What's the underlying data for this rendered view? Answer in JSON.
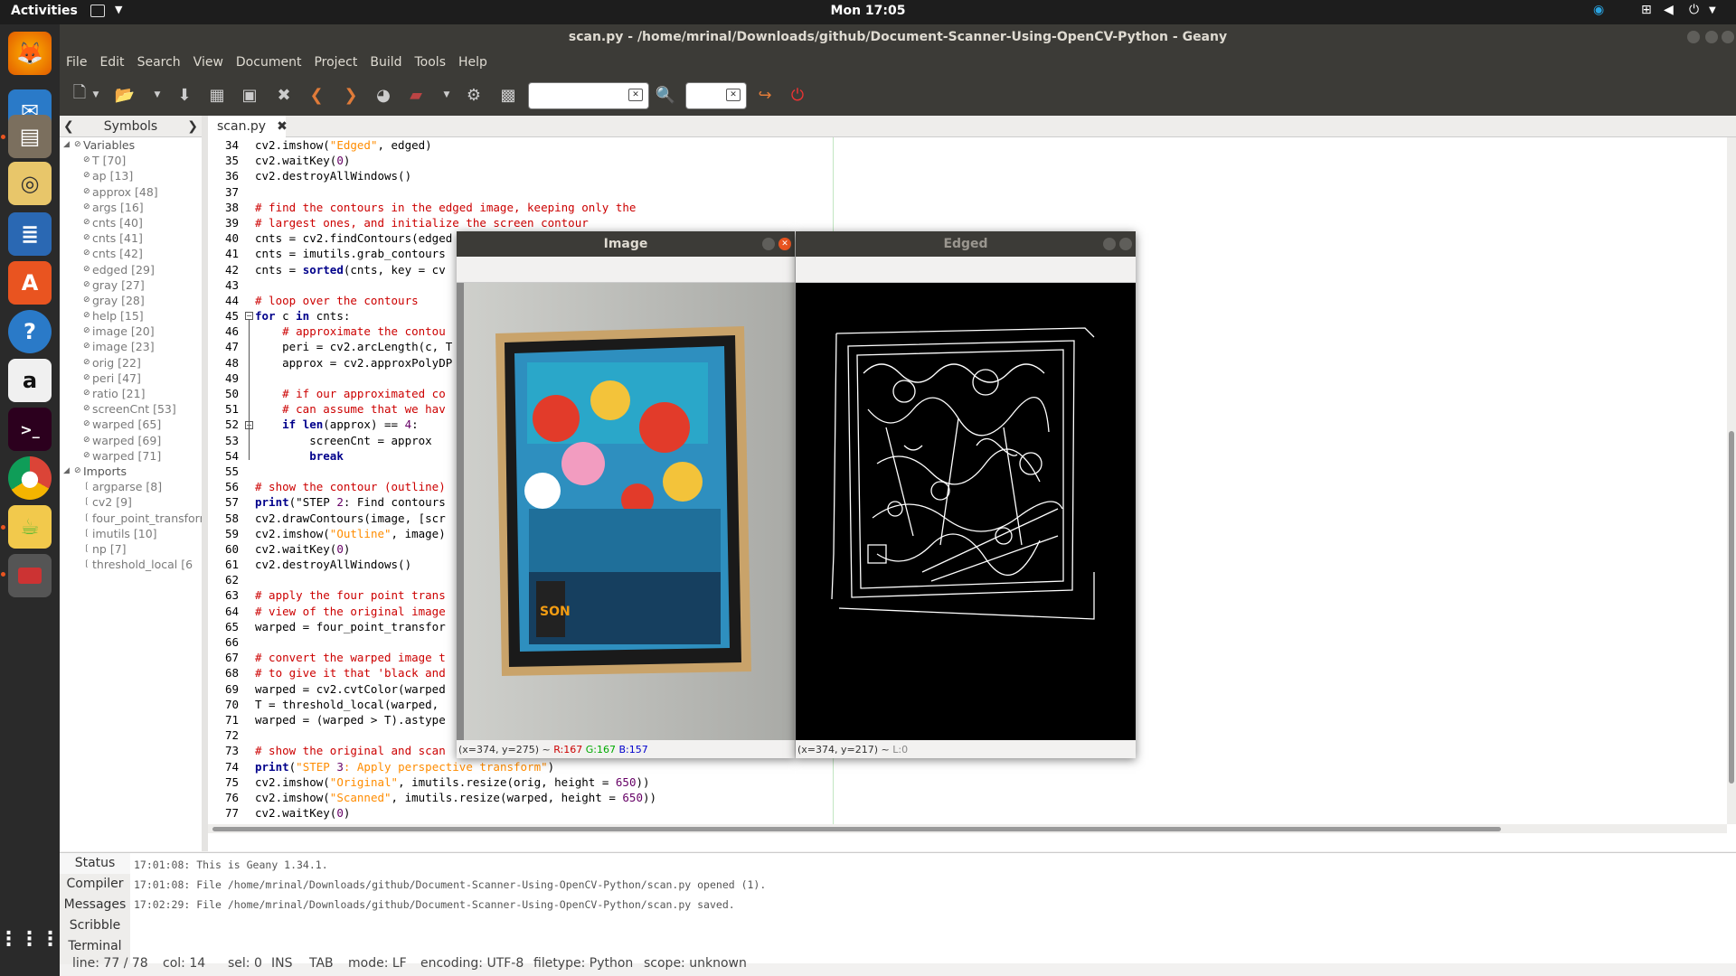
{
  "topbar": {
    "activities": "Activities",
    "clock": "Mon 17:05"
  },
  "dock": {
    "items": [
      "firefox-icon",
      "thunderbird-icon",
      "files-icon",
      "rhythmbox-icon",
      "writer-icon",
      "software-center-icon",
      "help-icon",
      "amazon-icon",
      "terminal-icon",
      "chrome-icon",
      "geany-icon",
      "app-icon"
    ]
  },
  "window": {
    "title": "scan.py - /home/mrinal/Downloads/github/Document-Scanner-Using-OpenCV-Python - Geany"
  },
  "menu": [
    "File",
    "Edit",
    "Search",
    "View",
    "Document",
    "Project",
    "Build",
    "Tools",
    "Help"
  ],
  "sidebar": {
    "title": "Symbols",
    "variables_label": "Variables",
    "variables": [
      "T [70]",
      "ap [13]",
      "approx [48]",
      "args [16]",
      "cnts [40]",
      "cnts [41]",
      "cnts [42]",
      "edged [29]",
      "gray [27]",
      "gray [28]",
      "help [15]",
      "image [20]",
      "image [23]",
      "orig [22]",
      "peri [47]",
      "ratio [21]",
      "screenCnt [53]",
      "warped [65]",
      "warped [69]",
      "warped [71]"
    ],
    "imports_label": "Imports",
    "imports": [
      "argparse [8]",
      "cv2 [9]",
      "four_point_transform",
      "imutils [10]",
      "np [7]",
      "threshold_local [6"
    ]
  },
  "tab": {
    "label": "scan.py",
    "close": "✖"
  },
  "line_numbers": [
    "34",
    "35",
    "36",
    "37",
    "38",
    "39",
    "40",
    "41",
    "42",
    "43",
    "44",
    "45",
    "46",
    "47",
    "48",
    "49",
    "50",
    "51",
    "52",
    "53",
    "54",
    "55",
    "56",
    "57",
    "58",
    "59",
    "60",
    "61",
    "62",
    "63",
    "64",
    "65",
    "66",
    "67",
    "68",
    "69",
    "70",
    "71",
    "72",
    "73",
    "74",
    "75",
    "76",
    "77"
  ],
  "code": [
    "cv2.imshow(\"Edged\", edged)",
    "cv2.waitKey(0)",
    "cv2.destroyAllWindows()",
    "",
    "# find the contours in the edged image, keeping only the",
    "# largest ones, and initialize the screen contour",
    "cnts = cv2.findContours(edged",
    "cnts = imutils.grab_contours",
    "cnts = sorted(cnts, key = cv",
    "",
    "# loop over the contours",
    "for c in cnts:",
    "    # approximate the contou",
    "    peri = cv2.arcLength(c, T",
    "    approx = cv2.approxPolyDP",
    "",
    "    # if our approximated co",
    "    # can assume that we hav",
    "    if len(approx) == 4:",
    "        screenCnt = approx",
    "        break",
    "",
    "# show the contour (outline)",
    "print(\"STEP 2: Find contours",
    "cv2.drawContours(image, [scr",
    "cv2.imshow(\"Outline\", image)",
    "cv2.waitKey(0)",
    "cv2.destroyAllWindows()",
    "",
    "# apply the four point trans",
    "# view of the original image",
    "warped = four_point_transfor",
    "",
    "# convert the warped image t",
    "# to give it that 'black and",
    "warped = cv2.cvtColor(warped",
    "T = threshold_local(warped, ",
    "warped = (warped > T).astype",
    "",
    "# show the original and scan",
    "print(\"STEP 3: Apply perspective transform\")",
    "cv2.imshow(\"Original\", imutils.resize(orig, height = 650))",
    "cv2.imshow(\"Scanned\", imutils.resize(warped, height = 650))",
    "cv2.waitKey(0)"
  ],
  "messages": {
    "tabs": [
      "Status",
      "Compiler",
      "Messages",
      "Scribble",
      "Terminal"
    ],
    "lines": [
      "17:01:08: This is Geany 1.34.1.",
      "17:01:08: File /home/mrinal/Downloads/github/Document-Scanner-Using-OpenCV-Python/scan.py opened (1).",
      "17:02:29: File /home/mrinal/Downloads/github/Document-Scanner-Using-OpenCV-Python/scan.py saved."
    ]
  },
  "statusbar": {
    "line": "line: 77 / 78",
    "col": "col: 14",
    "sel": "sel: 0",
    "ins": "INS",
    "tab": "TAB",
    "mode": "mode: LF",
    "encoding": "encoding: UTF-8",
    "filetype": "filetype: Python",
    "scope": "scope: unknown"
  },
  "cv_image": {
    "title": "Image",
    "status_coord": "(x=374, y=275) ~",
    "r": "R:167",
    "g": "G:167",
    "b": "B:157"
  },
  "cv_edged": {
    "title": "Edged",
    "status_coord": "(x=374, y=217) ~",
    "l": "L:0"
  },
  "colors": {
    "comment": "#cc0000",
    "keyword": "#00008b",
    "string": "#ff8c00",
    "accent": "#e95420"
  }
}
